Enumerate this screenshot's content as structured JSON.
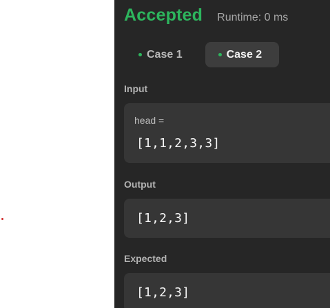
{
  "result": {
    "status": "Accepted",
    "runtime": "Runtime: 0 ms"
  },
  "tabs": [
    {
      "label": "Case 1",
      "active": false
    },
    {
      "label": "Case 2",
      "active": true
    }
  ],
  "input": {
    "label": "Input",
    "variable": "head =",
    "value": "[1,1,2,3,3]"
  },
  "output": {
    "label": "Output",
    "value": "[1,2,3]"
  },
  "expected": {
    "label": "Expected",
    "value": "[1,2,3]"
  },
  "colors": {
    "accepted": "#2db55d",
    "panel_background": "#262626",
    "box_background": "#363636",
    "active_tab_background": "#3d3d3d"
  }
}
